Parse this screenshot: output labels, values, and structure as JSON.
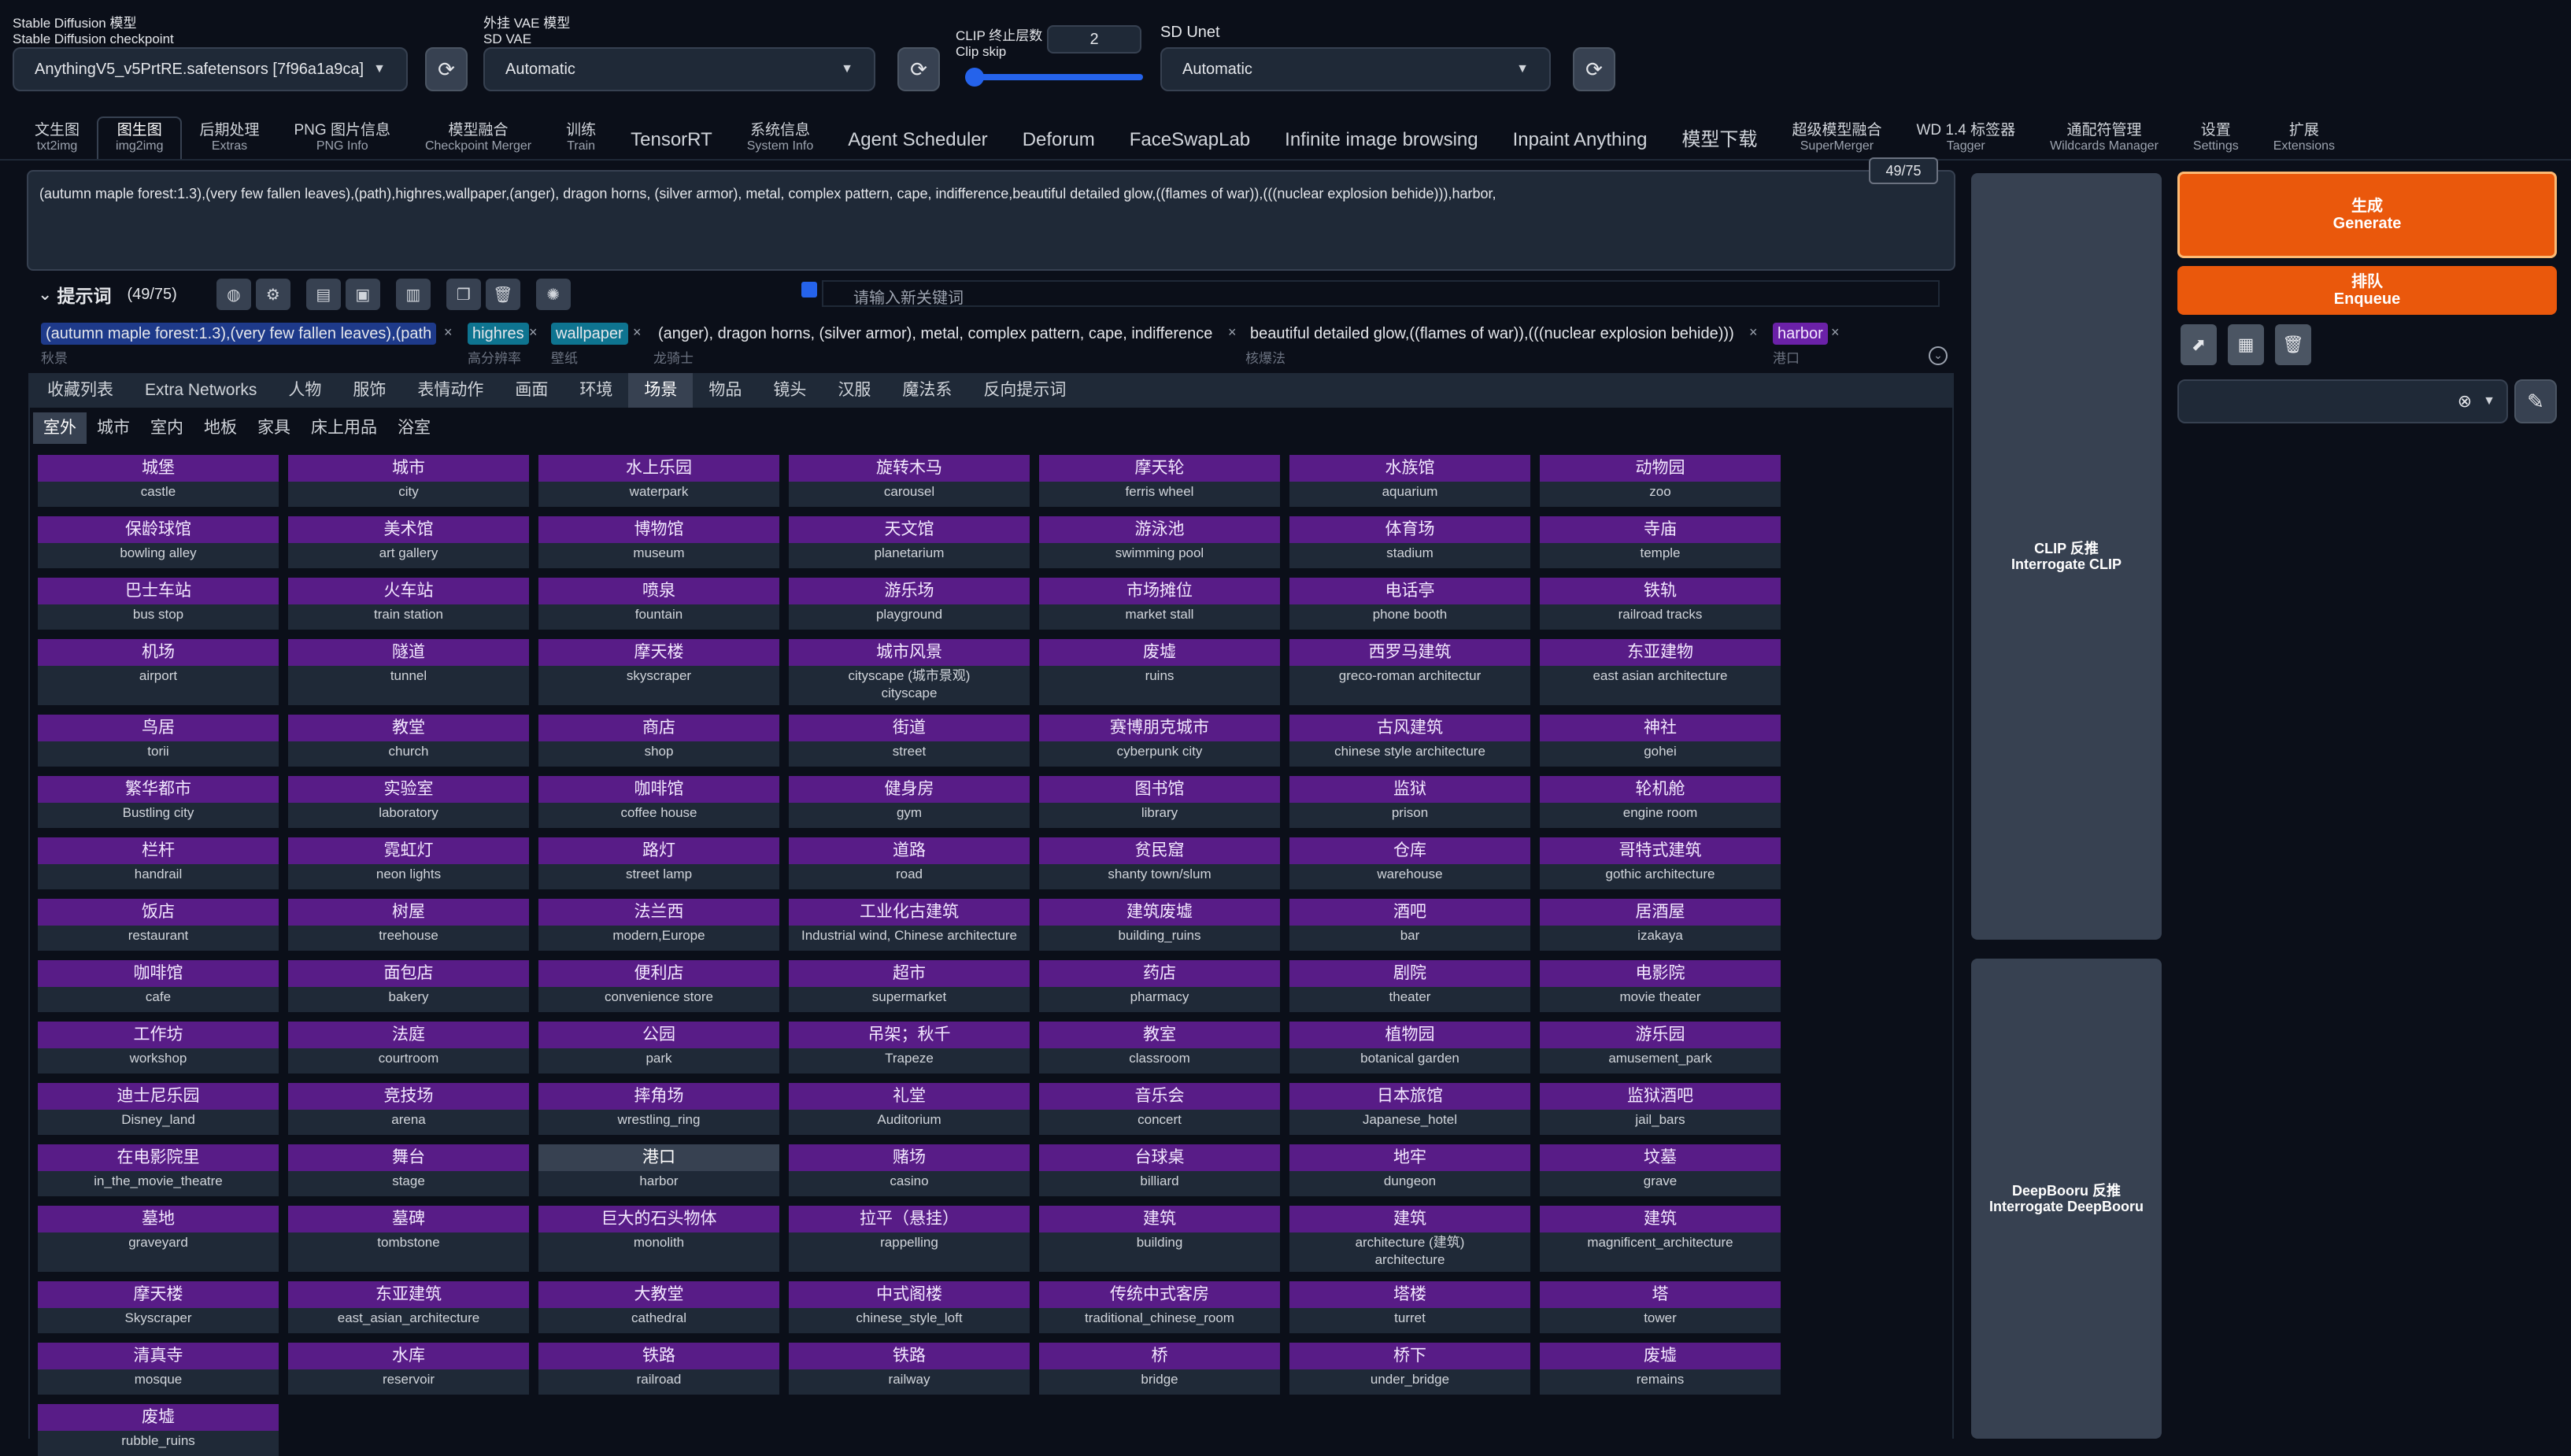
{
  "header": {
    "checkpoint_label_zh": "Stable Diffusion 模型",
    "checkpoint_label_en": "Stable Diffusion checkpoint",
    "checkpoint_value": "AnythingV5_v5PrtRE.safetensors [7f96a1a9ca]",
    "vae_label_zh": "外挂 VAE 模型",
    "vae_label_en": "SD VAE",
    "vae_value": "Automatic",
    "clip_label_zh": "CLIP 终止层数",
    "clip_label_en": "Clip skip",
    "clip_value": "2",
    "clip_slider_fraction": 0.0,
    "unet_label": "SD Unet",
    "unet_value": "Automatic",
    "refresh_icon": "refresh-icon"
  },
  "tabs": [
    {
      "l1": "文生图",
      "l2": "txt2img"
    },
    {
      "l1": "图生图",
      "l2": "img2img",
      "active": true
    },
    {
      "l1": "后期处理",
      "l2": "Extras"
    },
    {
      "l1": "PNG 图片信息",
      "l2": "PNG Info"
    },
    {
      "l1": "模型融合",
      "l2": "Checkpoint Merger"
    },
    {
      "l1": "训练",
      "l2": "Train"
    },
    {
      "l1": "TensorRT",
      "l2": ""
    },
    {
      "l1": "系统信息",
      "l2": "System Info"
    },
    {
      "l1": "Agent Scheduler",
      "l2": ""
    },
    {
      "l1": "Deforum",
      "l2": ""
    },
    {
      "l1": "FaceSwapLab",
      "l2": ""
    },
    {
      "l1": "Infinite image browsing",
      "l2": ""
    },
    {
      "l1": "Inpaint Anything",
      "l2": ""
    },
    {
      "l1": "模型下载",
      "l2": ""
    },
    {
      "l1": "超级模型融合",
      "l2": "SuperMerger"
    },
    {
      "l1": "WD 1.4 标签器",
      "l2": "Tagger"
    },
    {
      "l1": "通配符管理",
      "l2": "Wildcards Manager"
    },
    {
      "l1": "设置",
      "l2": "Settings"
    },
    {
      "l1": "扩展",
      "l2": "Extensions"
    }
  ],
  "prompt": {
    "text": "(autumn maple forest:1.3),(very few fallen leaves),(path),highres,wallpaper,(anger), dragon horns, (silver armor), metal, complex pattern, cape, indifference,beautiful detailed glow,((flames of war)),(((nuclear explosion behide))),harbor,",
    "token_count": "49/75"
  },
  "tag_toolbar": {
    "title": "提示词",
    "count": "(49/75)",
    "new_keyword_placeholder": "请输入新关键词"
  },
  "chips": {
    "c1": "(autumn maple forest:1.3),(very few fallen leaves),(path",
    "c1_sub": "秋景",
    "c2": "highres",
    "c2_sub": "高分辨率",
    "c3": "wallpaper",
    "c3_sub": "壁纸",
    "c4": "(anger), dragon horns, (silver armor), metal, complex pattern, cape, indifference",
    "c4_sub": "龙骑士",
    "c5": "beautiful detailed glow,((flames of war)),(((nuclear explosion behide)))",
    "c5_sub": "核爆法",
    "c6": "harbor",
    "c6_sub": "港口"
  },
  "categories": [
    "收藏列表",
    "Extra Networks",
    "人物",
    "服饰",
    "表情动作",
    "画面",
    "环境",
    "场景",
    "物品",
    "镜头",
    "汉服",
    "魔法系",
    "反向提示词"
  ],
  "active_category": "场景",
  "subcategories": [
    "室外",
    "城市",
    "室内",
    "地板",
    "家具",
    "床上用品",
    "浴室"
  ],
  "active_subcategory": "室外",
  "tiles": [
    {
      "zh": "城堡",
      "en": "castle"
    },
    {
      "zh": "城市",
      "en": "city"
    },
    {
      "zh": "水上乐园",
      "en": "waterpark"
    },
    {
      "zh": "旋转木马",
      "en": "carousel"
    },
    {
      "zh": "摩天轮",
      "en": "ferris wheel"
    },
    {
      "zh": "水族馆",
      "en": "aquarium"
    },
    {
      "zh": "动物园",
      "en": "zoo"
    },
    {
      "zh": "保龄球馆",
      "en": "bowling alley"
    },
    {
      "zh": "美术馆",
      "en": "art gallery"
    },
    {
      "zh": "博物馆",
      "en": "museum"
    },
    {
      "zh": "天文馆",
      "en": "planetarium"
    },
    {
      "zh": "游泳池",
      "en": "swimming pool"
    },
    {
      "zh": "体育场",
      "en": "stadium"
    },
    {
      "zh": "寺庙",
      "en": "temple"
    },
    {
      "zh": "巴士车站",
      "en": "bus stop"
    },
    {
      "zh": "火车站",
      "en": "train station"
    },
    {
      "zh": "喷泉",
      "en": "fountain"
    },
    {
      "zh": "游乐场",
      "en": "playground"
    },
    {
      "zh": "市场摊位",
      "en": "market stall"
    },
    {
      "zh": "电话亭",
      "en": "phone booth"
    },
    {
      "zh": "铁轨",
      "en": "railroad tracks"
    },
    {
      "zh": "机场",
      "en": "airport"
    },
    {
      "zh": "隧道",
      "en": "tunnel"
    },
    {
      "zh": "摩天楼",
      "en": "skyscraper"
    },
    {
      "zh": "城市风景",
      "en": "cityscape (城市景观)\ncityscape"
    },
    {
      "zh": "废墟",
      "en": "ruins"
    },
    {
      "zh": "西罗马建筑",
      "en": "greco-roman architectur"
    },
    {
      "zh": "东亚建物",
      "en": "east asian architecture"
    },
    {
      "zh": "鸟居",
      "en": "torii"
    },
    {
      "zh": "教堂",
      "en": "church"
    },
    {
      "zh": "商店",
      "en": "shop"
    },
    {
      "zh": "街道",
      "en": "street"
    },
    {
      "zh": "赛博朋克城市",
      "en": "cyberpunk city"
    },
    {
      "zh": "古风建筑",
      "en": "chinese style architecture"
    },
    {
      "zh": "神社",
      "en": "gohei"
    },
    {
      "zh": "繁华都市",
      "en": "Bustling city"
    },
    {
      "zh": "实验室",
      "en": "laboratory"
    },
    {
      "zh": "咖啡馆",
      "en": "coffee house"
    },
    {
      "zh": "健身房",
      "en": "gym"
    },
    {
      "zh": "图书馆",
      "en": "library"
    },
    {
      "zh": "监狱",
      "en": "prison"
    },
    {
      "zh": "轮机舱",
      "en": "engine room"
    },
    {
      "zh": "栏杆",
      "en": "handrail"
    },
    {
      "zh": "霓虹灯",
      "en": "neon lights"
    },
    {
      "zh": "路灯",
      "en": "street lamp"
    },
    {
      "zh": "道路",
      "en": "road"
    },
    {
      "zh": "贫民窟",
      "en": "shanty town/slum"
    },
    {
      "zh": "仓库",
      "en": "warehouse"
    },
    {
      "zh": "哥特式建筑",
      "en": "gothic architecture"
    },
    {
      "zh": "饭店",
      "en": "restaurant"
    },
    {
      "zh": "树屋",
      "en": "treehouse"
    },
    {
      "zh": "法兰西",
      "en": "modern,Europe"
    },
    {
      "zh": "工业化古建筑",
      "en": "Industrial wind, Chinese architecture"
    },
    {
      "zh": "建筑废墟",
      "en": "building_ruins"
    },
    {
      "zh": "酒吧",
      "en": "bar"
    },
    {
      "zh": "居酒屋",
      "en": "izakaya"
    },
    {
      "zh": "咖啡馆",
      "en": "cafe"
    },
    {
      "zh": "面包店",
      "en": "bakery"
    },
    {
      "zh": "便利店",
      "en": "convenience store"
    },
    {
      "zh": "超市",
      "en": "supermarket"
    },
    {
      "zh": "药店",
      "en": "pharmacy"
    },
    {
      "zh": "剧院",
      "en": "theater"
    },
    {
      "zh": "电影院",
      "en": "movie theater"
    },
    {
      "zh": "工作坊",
      "en": "workshop"
    },
    {
      "zh": "法庭",
      "en": "courtroom"
    },
    {
      "zh": "公园",
      "en": "park"
    },
    {
      "zh": "吊架；秋千",
      "en": "Trapeze"
    },
    {
      "zh": "教室",
      "en": "classroom"
    },
    {
      "zh": "植物园",
      "en": "botanical garden"
    },
    {
      "zh": "游乐园",
      "en": "amusement_park"
    },
    {
      "zh": "迪士尼乐园",
      "en": "Disney_land"
    },
    {
      "zh": "竞技场",
      "en": "arena"
    },
    {
      "zh": "摔角场",
      "en": "wrestling_ring"
    },
    {
      "zh": "礼堂",
      "en": "Auditorium"
    },
    {
      "zh": "音乐会",
      "en": "concert"
    },
    {
      "zh": "日本旅馆",
      "en": "Japanese_hotel"
    },
    {
      "zh": "监狱酒吧",
      "en": "jail_bars"
    },
    {
      "zh": "在电影院里",
      "en": "in_the_movie_theatre"
    },
    {
      "zh": "舞台",
      "en": "stage"
    },
    {
      "zh": "港口",
      "en": "harbor",
      "gray": true
    },
    {
      "zh": "赌场",
      "en": "casino"
    },
    {
      "zh": "台球桌",
      "en": "billiard"
    },
    {
      "zh": "地牢",
      "en": "dungeon"
    },
    {
      "zh": "坟墓",
      "en": "grave"
    },
    {
      "zh": "墓地",
      "en": "graveyard"
    },
    {
      "zh": "墓碑",
      "en": "tombstone"
    },
    {
      "zh": "巨大的石头物体",
      "en": "monolith"
    },
    {
      "zh": "拉平（悬挂）",
      "en": "rappelling"
    },
    {
      "zh": "建筑",
      "en": "building"
    },
    {
      "zh": "建筑",
      "en": "architecture (建筑)\narchitecture"
    },
    {
      "zh": "建筑",
      "en": "magnificent_architecture"
    },
    {
      "zh": "摩天楼",
      "en": "Skyscraper"
    },
    {
      "zh": "东亚建筑",
      "en": "east_asian_architecture"
    },
    {
      "zh": "大教堂",
      "en": "cathedral"
    },
    {
      "zh": "中式阁楼",
      "en": "chinese_style_loft"
    },
    {
      "zh": "传统中式客房",
      "en": "traditional_chinese_room"
    },
    {
      "zh": "塔楼",
      "en": "turret"
    },
    {
      "zh": "塔",
      "en": "tower"
    },
    {
      "zh": "清真寺",
      "en": "mosque"
    },
    {
      "zh": "水库",
      "en": "reservoir"
    },
    {
      "zh": "铁路",
      "en": "railroad"
    },
    {
      "zh": "铁路",
      "en": "railway"
    },
    {
      "zh": "桥",
      "en": "bridge"
    },
    {
      "zh": "桥下",
      "en": "under_bridge"
    },
    {
      "zh": "废墟",
      "en": "remains"
    },
    {
      "zh": "废墟",
      "en": "rubble_ruins"
    }
  ],
  "side": {
    "interrogate_clip_zh": "CLIP 反推",
    "interrogate_clip_en": "Interrogate CLIP",
    "interrogate_db_zh": "DeepBooru 反推",
    "interrogate_db_en": "Interrogate DeepBooru",
    "generate_zh": "生成",
    "generate_en": "Generate",
    "enqueue_zh": "排队",
    "enqueue_en": "Enqueue",
    "accent": "#ea580c"
  }
}
